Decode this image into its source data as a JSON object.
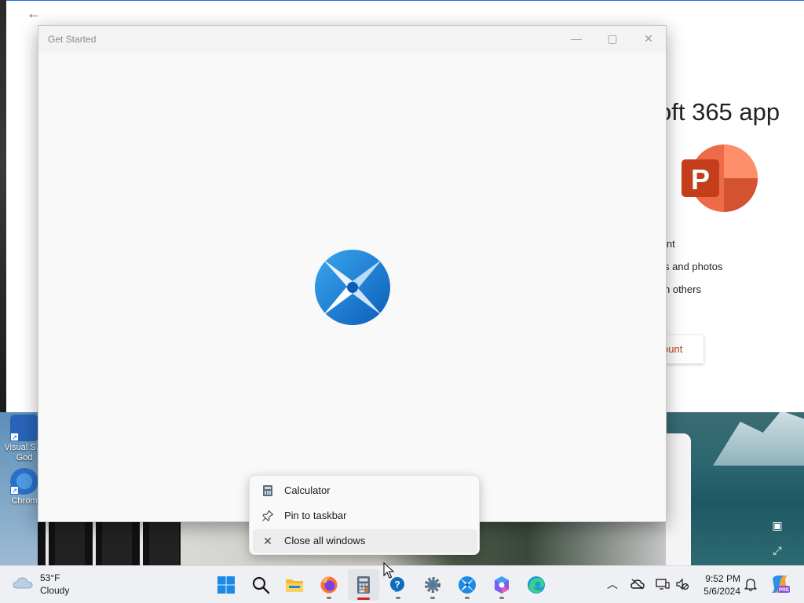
{
  "desktop": {
    "icons": [
      {
        "label": "Visual S… God",
        "icon": "visual-studio-shortcut-icon"
      },
      {
        "label": "Chrom",
        "icon": "chrome-shortcut-icon"
      }
    ]
  },
  "background_app": {
    "headline": "oft 365 app",
    "features": [
      "int",
      "s and photos",
      "h others"
    ],
    "account_button": "ount",
    "logo": "powerpoint-logo-icon"
  },
  "window": {
    "title": "Get Started",
    "controls": {
      "minimize": "—",
      "maximize": "▢",
      "close": "✕"
    },
    "logo": "get-started-logo-icon"
  },
  "jump_list": {
    "items": [
      {
        "label": "Calculator",
        "icon": "calculator-icon"
      },
      {
        "label": "Pin to taskbar",
        "icon": "pin-icon"
      },
      {
        "label": "Close all windows",
        "icon": "close-icon"
      }
    ]
  },
  "taskbar": {
    "weather": {
      "temp": "53°F",
      "condition": "Cloudy",
      "icon": "cloudy-icon"
    },
    "apps": [
      {
        "name": "start",
        "icon": "windows-start-icon"
      },
      {
        "name": "search",
        "icon": "search-icon"
      },
      {
        "name": "file-explorer",
        "icon": "folder-icon"
      },
      {
        "name": "firefox",
        "icon": "firefox-icon"
      },
      {
        "name": "calculator",
        "icon": "calculator-icon"
      },
      {
        "name": "get-help",
        "icon": "help-icon"
      },
      {
        "name": "settings",
        "icon": "gear-icon"
      },
      {
        "name": "get-started",
        "icon": "get-started-icon"
      },
      {
        "name": "copilot",
        "icon": "copilot-icon"
      },
      {
        "name": "edge",
        "icon": "edge-icon"
      }
    ],
    "tray": {
      "time": "9:52 PM",
      "date": "5/6/2024"
    }
  },
  "colors": {
    "accent": "#0067c0",
    "running_indicator": "#c42b1c",
    "powerpoint": "#c43e1c"
  }
}
